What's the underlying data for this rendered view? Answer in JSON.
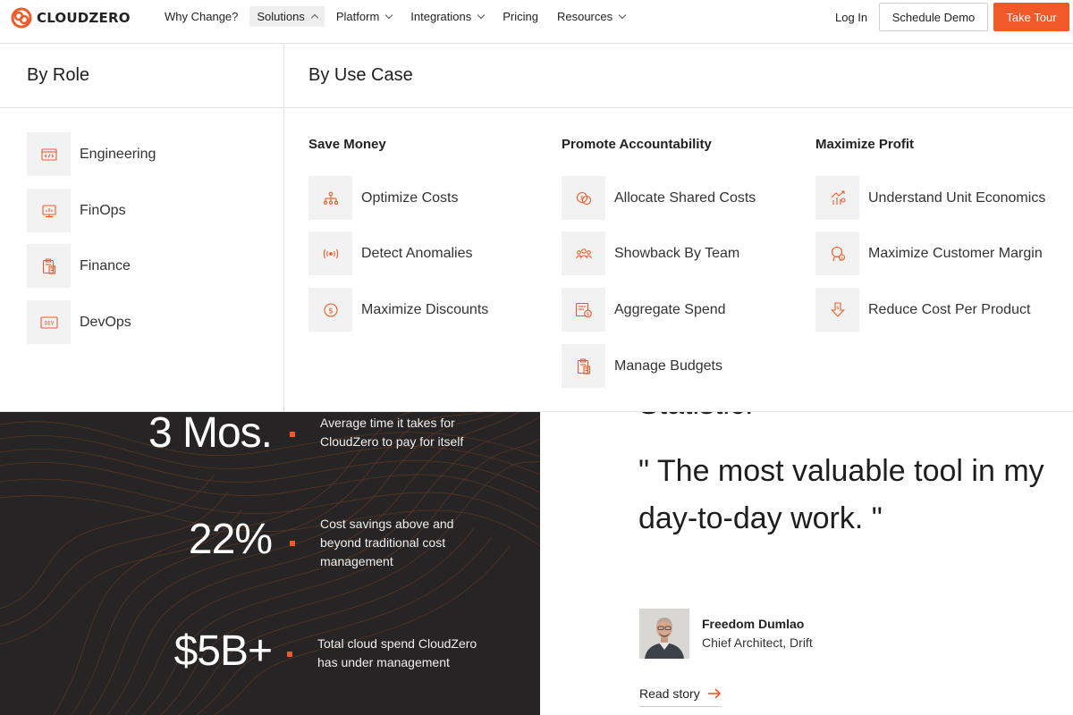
{
  "brand": {
    "name": "CLOUDZERO",
    "accent": "#f05a28",
    "logo_icon": "cloudzero-logo-icon"
  },
  "nav": {
    "items": [
      {
        "label": "Why Change?",
        "has_dropdown": false
      },
      {
        "label": "Solutions",
        "has_dropdown": true,
        "open": true
      },
      {
        "label": "Platform",
        "has_dropdown": true
      },
      {
        "label": "Integrations",
        "has_dropdown": true
      },
      {
        "label": "Pricing",
        "has_dropdown": false
      },
      {
        "label": "Resources",
        "has_dropdown": true
      }
    ],
    "login": "Log In",
    "schedule_demo": "Schedule Demo",
    "take_tour": "Take Tour"
  },
  "mega": {
    "by_role": {
      "title": "By Role",
      "items": [
        {
          "label": "Engineering",
          "icon": "code-window-icon"
        },
        {
          "label": "FinOps",
          "icon": "monitor-chart-icon"
        },
        {
          "label": "Finance",
          "icon": "clipboard-calculator-icon"
        },
        {
          "label": "DevOps",
          "icon": "dev-badge-icon"
        }
      ]
    },
    "by_use_case": {
      "title": "By Use Case",
      "groups": [
        {
          "title": "Save Money",
          "items": [
            {
              "label": "Optimize Costs",
              "icon": "hierarchy-icon"
            },
            {
              "label": "Detect Anomalies",
              "icon": "signal-icon"
            },
            {
              "label": "Maximize Discounts",
              "icon": "dollar-circle-icon"
            }
          ]
        },
        {
          "title": "Promote Accountability",
          "items": [
            {
              "label": "Allocate Shared Costs",
              "icon": "shared-cost-icon"
            },
            {
              "label": "Showback By Team",
              "icon": "team-icon"
            },
            {
              "label": "Aggregate Spend",
              "icon": "document-spend-icon"
            },
            {
              "label": "Manage Budgets",
              "icon": "budget-calculator-icon"
            }
          ]
        },
        {
          "title": "Maximize Profit",
          "items": [
            {
              "label": "Understand Unit Economics",
              "icon": "growth-chart-icon"
            },
            {
              "label": "Maximize Customer Margin",
              "icon": "customer-margin-icon"
            },
            {
              "label": "Reduce Cost Per Product",
              "icon": "reduce-arrow-icon"
            }
          ]
        }
      ]
    }
  },
  "stats": [
    {
      "value": "3 Mos.",
      "description": "Average time it takes for CloudZero to pay for itself"
    },
    {
      "value": "22%",
      "description": "Cost savings above and beyond traditional cost management"
    },
    {
      "value": "$5B+",
      "description": "Total cloud spend CloudZero has under management"
    }
  ],
  "testimonial": {
    "partial_heading": "Statistic.",
    "quote": "\" The most valuable tool in my day-to-day work. \"",
    "name": "Freedom Dumlao",
    "role": "Chief Architect, Drift",
    "link": "Read story"
  }
}
